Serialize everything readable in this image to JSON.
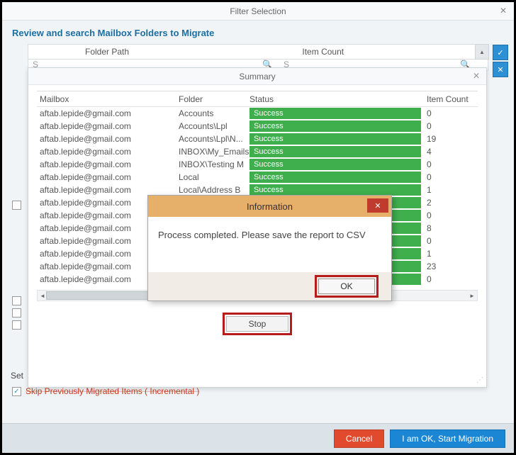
{
  "outer": {
    "title": "Filter Selection",
    "subtitle": "Review and search Mailbox Folders to Migrate",
    "columns": {
      "folder_path": "Folder Path",
      "item_count": "Item Count"
    },
    "search_placeholder": "S",
    "set_label": "Set",
    "skip_label": "Skip Previously Migrated Items ( Incremental )"
  },
  "footer": {
    "cancel": "Cancel",
    "start": "I am OK, Start Migration"
  },
  "summary": {
    "title": "Summary",
    "headers": {
      "mailbox": "Mailbox",
      "folder": "Folder",
      "status": "Status",
      "item_count": "Item Count"
    },
    "rows": [
      {
        "mailbox": "aftab.lepide@gmail.com",
        "folder": "Accounts",
        "status": "Success",
        "count": "0"
      },
      {
        "mailbox": "aftab.lepide@gmail.com",
        "folder": "Accounts\\Lpl",
        "status": "Success",
        "count": "0"
      },
      {
        "mailbox": "aftab.lepide@gmail.com",
        "folder": "Accounts\\Lpl\\N...",
        "status": "Success",
        "count": "19"
      },
      {
        "mailbox": "aftab.lepide@gmail.com",
        "folder": "INBOX\\My_Emails",
        "status": "Success",
        "count": "4"
      },
      {
        "mailbox": "aftab.lepide@gmail.com",
        "folder": "INBOX\\Testing M",
        "status": "Success",
        "count": "0"
      },
      {
        "mailbox": "aftab.lepide@gmail.com",
        "folder": "Local",
        "status": "Success",
        "count": "0"
      },
      {
        "mailbox": "aftab.lepide@gmail.com",
        "folder": "Local\\Address B",
        "status": "Success",
        "count": "1"
      },
      {
        "mailbox": "aftab.lepide@gmail.com",
        "folder": "",
        "status": "",
        "count": "2"
      },
      {
        "mailbox": "aftab.lepide@gmail.com",
        "folder": "",
        "status": "",
        "count": "0"
      },
      {
        "mailbox": "aftab.lepide@gmail.com",
        "folder": "",
        "status": "",
        "count": "8"
      },
      {
        "mailbox": "aftab.lepide@gmail.com",
        "folder": "",
        "status": "",
        "count": "0"
      },
      {
        "mailbox": "aftab.lepide@gmail.com",
        "folder": "",
        "status": "",
        "count": "1"
      },
      {
        "mailbox": "aftab.lepide@gmail.com",
        "folder": "",
        "status": "",
        "count": "23"
      },
      {
        "mailbox": "aftab.lepide@gmail.com",
        "folder": "",
        "status": "",
        "count": "0"
      }
    ],
    "stop": "Stop"
  },
  "msgbox": {
    "title": "Information",
    "body": "Process completed. Please save the report to CSV",
    "ok": "OK"
  },
  "icons": {
    "check_all": "✓",
    "uncheck_all": "✕",
    "close": "✕",
    "up": "▲",
    "left": "◄",
    "right": "►",
    "search": "🔍"
  }
}
